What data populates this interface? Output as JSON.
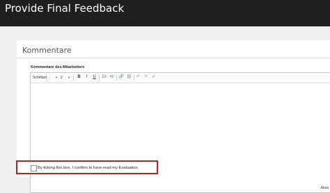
{
  "window": {
    "title": "Provide Final Feedback"
  },
  "section": {
    "title": "Kommentare"
  },
  "field": {
    "label": "Kommentare des Mitarbeiters"
  },
  "toolbar": {
    "font_select": "Schriftart",
    "size_select": "2",
    "bold": "B",
    "italic": "I",
    "underline": "U",
    "ordered_list": "1≡",
    "unordered_list": "•≡",
    "link": "🔗",
    "unlink": "⛓",
    "undo": "↶",
    "redo": "↷",
    "spell": "✓"
  },
  "editor": {
    "footer": "Absä"
  },
  "confirm": {
    "label": "By ticking this box, I confirm to have read my Evaluation",
    "checked": false
  },
  "colors": {
    "titlebar": "#1f1f1f",
    "highlight": "#c21d1d"
  }
}
